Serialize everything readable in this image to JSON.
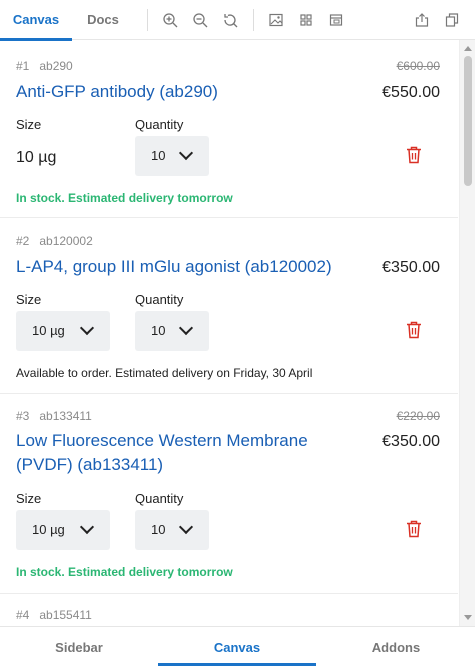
{
  "toolbar": {
    "tabs": [
      "Canvas",
      "Docs"
    ],
    "icons": [
      "zoom-in-icon",
      "zoom-out-icon",
      "reset-zoom-icon",
      "image-icon",
      "grid-icon",
      "layout-icon",
      "export-icon",
      "copy-icon"
    ]
  },
  "labels": {
    "size": "Size",
    "quantity": "Quantity"
  },
  "items": [
    {
      "num": "#1",
      "code": "ab290",
      "old_price": "€600.00",
      "title": "Anti-GFP antibody (ab290)",
      "price": "€550.00",
      "size": "10 µg",
      "quantity": "10",
      "status": "In stock. Estimated delivery tomorrow"
    },
    {
      "num": "#2",
      "code": "ab120002",
      "old_price": "",
      "title": "L-AP4, group III mGlu agonist (ab120002)",
      "price": "€350.00",
      "size": "10 µg",
      "quantity": "10",
      "status": "Available to order. Estimated delivery on Friday, 30 April"
    },
    {
      "num": "#3",
      "code": "ab133411",
      "old_price": "€220.00",
      "title": "Low Fluorescence Western Membrane (PVDF) (ab133411)",
      "price": "€350.00",
      "size": "10 µg",
      "quantity": "10",
      "status": "In stock. Estimated delivery tomorrow"
    },
    {
      "num": "#4",
      "code": "ab155411"
    }
  ],
  "bottom_nav": [
    "Sidebar",
    "Canvas",
    "Addons"
  ],
  "colors": {
    "accent": "#1a73c8",
    "link": "#1a5fb4",
    "in_stock": "#2bb673",
    "delete": "#d93025"
  }
}
